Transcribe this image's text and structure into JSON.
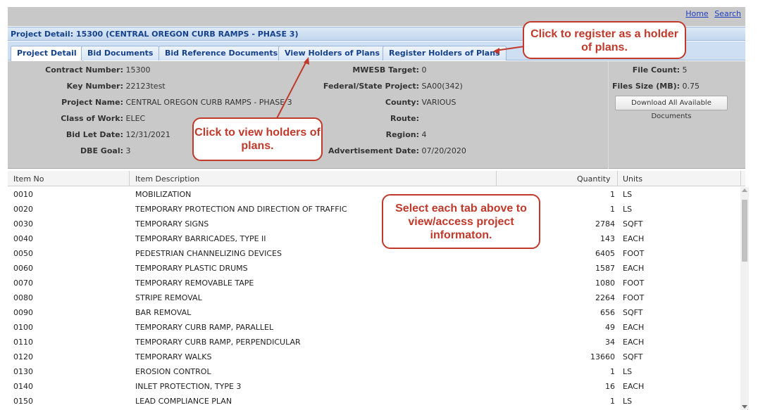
{
  "top_links": {
    "home": "Home",
    "search": "Search"
  },
  "title": "Project Detail: 15300 (CENTRAL OREGON CURB RAMPS - PHASE 3)",
  "tabs": [
    {
      "label": "Project Detail",
      "active": true
    },
    {
      "label": "Bid Documents",
      "active": false
    },
    {
      "label": "Bid Reference Documents",
      "active": false
    },
    {
      "label": "View Holders of Plans",
      "active": false
    },
    {
      "label": "Register Holders of Plans",
      "active": false
    }
  ],
  "info": {
    "contract_number": {
      "label": "Contract Number:",
      "value": "15300"
    },
    "key_number": {
      "label": "Key Number:",
      "value": "22123test"
    },
    "project_name": {
      "label": "Project Name:",
      "value": "CENTRAL OREGON CURB RAMPS - PHASE 3"
    },
    "class_of_work": {
      "label": "Class of Work:",
      "value": "ELEC"
    },
    "bid_let_date": {
      "label": "Bid Let Date:",
      "value": "12/31/2021"
    },
    "dbe_goal": {
      "label": "DBE Goal:",
      "value": "3"
    },
    "mwesb_target": {
      "label": "MWESB Target:",
      "value": "0"
    },
    "fed_state_project": {
      "label": "Federal/State Project:",
      "value": "SA00(342)"
    },
    "county": {
      "label": "County:",
      "value": "VARIOUS"
    },
    "route": {
      "label": "Route:",
      "value": ""
    },
    "region": {
      "label": "Region:",
      "value": "4"
    },
    "advertisement_date": {
      "label": "Advertisement Date:",
      "value": "07/20/2020"
    },
    "file_count": {
      "label": "File Count:",
      "value": "5"
    },
    "files_size": {
      "label": "Files Size (MB):",
      "value": "0.75"
    },
    "download_button": "Download All Available Documents"
  },
  "grid": {
    "columns": [
      "Item No",
      "Item Description",
      "Quantity",
      "Units"
    ],
    "rows": [
      [
        "0010",
        "MOBILIZATION",
        "1",
        "LS"
      ],
      [
        "0020",
        "TEMPORARY PROTECTION AND DIRECTION OF TRAFFIC",
        "1",
        "LS"
      ],
      [
        "0030",
        "TEMPORARY SIGNS",
        "2784",
        "SQFT"
      ],
      [
        "0040",
        "TEMPORARY BARRICADES, TYPE II",
        "143",
        "EACH"
      ],
      [
        "0050",
        "PEDESTRIAN CHANNELIZING DEVICES",
        "6405",
        "FOOT"
      ],
      [
        "0060",
        "TEMPORARY PLASTIC DRUMS",
        "1587",
        "EACH"
      ],
      [
        "0070",
        "TEMPORARY REMOVABLE TAPE",
        "1080",
        "FOOT"
      ],
      [
        "0080",
        "STRIPE REMOVAL",
        "2264",
        "FOOT"
      ],
      [
        "0090",
        "BAR REMOVAL",
        "656",
        "SQFT"
      ],
      [
        "0100",
        "TEMPORARY CURB RAMP, PARALLEL",
        "49",
        "EACH"
      ],
      [
        "0110",
        "TEMPORARY CURB RAMP, PERPENDICULAR",
        "34",
        "EACH"
      ],
      [
        "0120",
        "TEMPORARY WALKS",
        "13660",
        "SQFT"
      ],
      [
        "0130",
        "EROSION CONTROL",
        "1",
        "LS"
      ],
      [
        "0140",
        "INLET PROTECTION, TYPE 3",
        "16",
        "EACH"
      ],
      [
        "0150",
        "LEAD COMPLIANCE PLAN",
        "1",
        "LS"
      ]
    ]
  },
  "callouts": {
    "register": "Click to register as a holder of plans.",
    "view": "Click to view holders of plans.",
    "tabs": "Select each tab above to view/access project informaton."
  },
  "colors": {
    "callout": "#c0392b",
    "title_text": "#15428b",
    "panel": "#c9c9c9"
  }
}
